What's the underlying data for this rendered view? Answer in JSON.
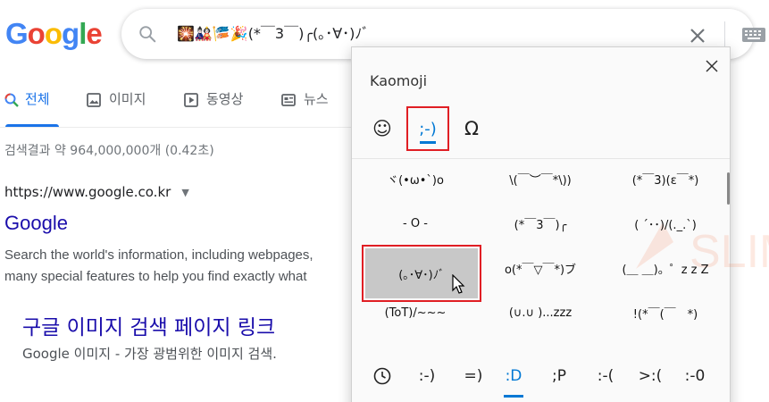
{
  "logo": {
    "letters": [
      "G",
      "o",
      "o",
      "g",
      "l",
      "e"
    ]
  },
  "search": {
    "query": "🎇🎎🎏🎉(*￣3￣)╭(｡･∀･)ﾉﾞ"
  },
  "tabs": [
    {
      "label": "전체",
      "icon": "search-icon"
    },
    {
      "label": "이미지",
      "icon": "image-icon"
    },
    {
      "label": "동영상",
      "icon": "video-icon"
    },
    {
      "label": "뉴스",
      "icon": "news-icon"
    }
  ],
  "stats": "검색결과 약 964,000,000개 (0.42초)",
  "result": {
    "url": "https://www.google.co.kr",
    "title": "Google",
    "snippet_line1": "Search the world's information, including webpages,",
    "snippet_line2": "many special features to help you find exactly what"
  },
  "sub_result": {
    "title": "구글 이미지 검색 페이지 링크",
    "snippet": "Google 이미지 - 가장 광범위한 이미지 검색."
  },
  "panel": {
    "title": "Kaomoji",
    "categories": [
      {
        "label": "☺",
        "icon": "smiley-icon"
      },
      {
        "label": ";-)",
        "icon": "kaomoji-icon"
      },
      {
        "label": "Ω",
        "icon": "symbols-icon"
      }
    ],
    "grid": [
      "ヾ(•ω•`)o",
      "\\(￣︶￣*\\))",
      "(*￣3)(ε￣*)",
      "- O -",
      "(*￣3￣)╭",
      "( ´･･)/(._.`)",
      "(｡･∀･)ﾉﾞ",
      "o(*￣▽￣*)ブ",
      "(＿ ＿)。゜z z Z",
      "(ToT)/~~~",
      "(∪.∪ )...zzz",
      "!(*￣(￣　*)"
    ],
    "bottom_tabs": [
      ":-)",
      "=)",
      ":D",
      ";P",
      ":-(",
      ">:(",
      ":-0"
    ],
    "history_icon": "clock-icon"
  },
  "watermark": {
    "text": "SLIM"
  }
}
